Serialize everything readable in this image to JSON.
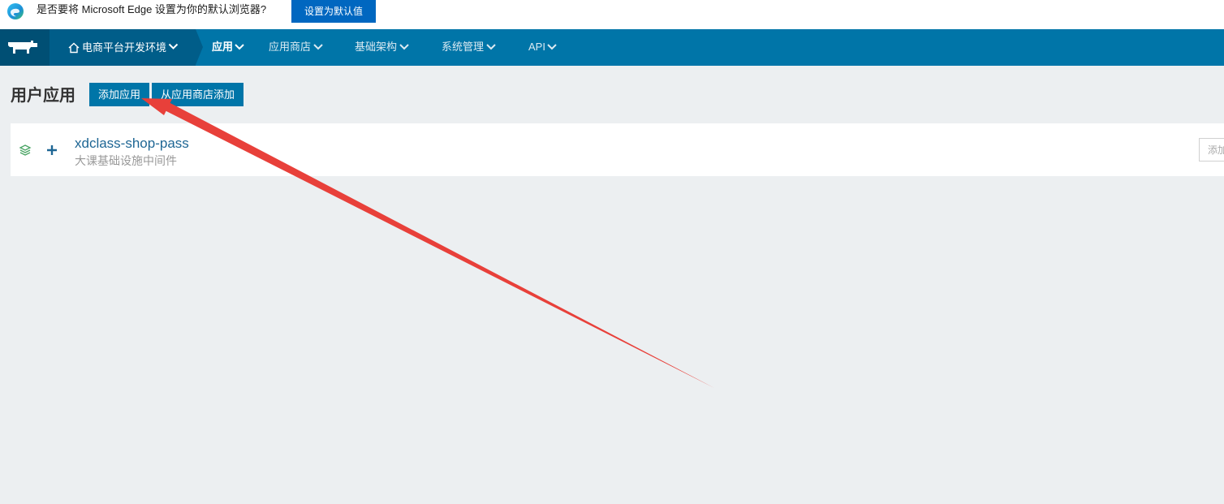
{
  "edge_prompt": {
    "message": "是否要将 Microsoft Edge 设置为你的默认浏览器?",
    "button_label": "设置为默认值"
  },
  "nav": {
    "environment": "电商平台开发环境",
    "items": [
      {
        "label": "应用",
        "active": true
      },
      {
        "label": "应用商店",
        "active": false
      },
      {
        "label": "基础架构",
        "active": false
      },
      {
        "label": "系统管理",
        "active": false
      },
      {
        "label": "API",
        "active": false
      }
    ]
  },
  "page": {
    "title": "用户应用",
    "add_app_label": "添加应用",
    "add_from_store_label": "从应用商店添加"
  },
  "apps": [
    {
      "name": "xdclass-shop-pass",
      "description": "大课基础设施中间件",
      "action_label": "添加"
    }
  ],
  "colors": {
    "nav_bg": "#0075a8",
    "nav_dark": "#005d89",
    "edge_button": "#0067c0",
    "annotation_arrow": "#e8403a"
  }
}
